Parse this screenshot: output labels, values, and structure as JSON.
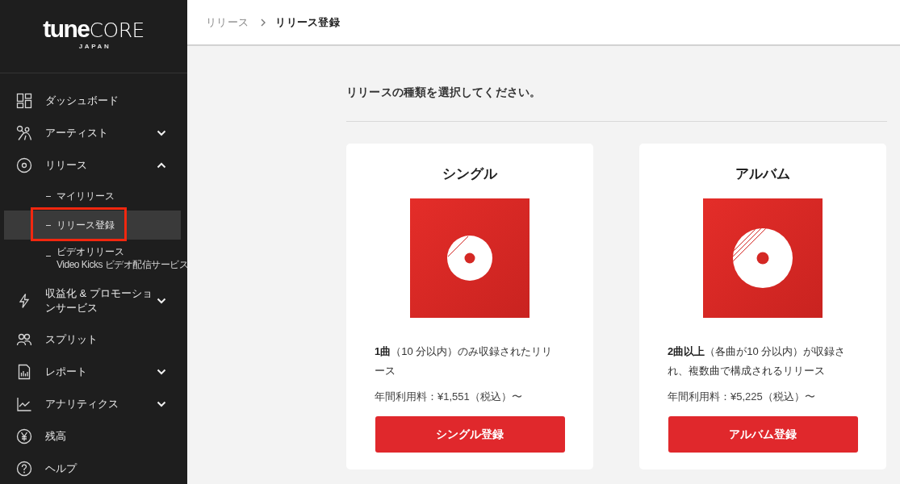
{
  "sidebar": {
    "logo": {
      "wordmark": "**tune**CORE",
      "subtitle": "JAPAN"
    },
    "items": [
      {
        "kind": "link",
        "label": "ダッシュボード"
      },
      {
        "kind": "group",
        "label": "アーティスト",
        "expanded": false
      },
      {
        "kind": "group",
        "label": "リリース",
        "expanded": true,
        "children": [
          {
            "label": "マイリリース",
            "selected": false,
            "annotated": false
          },
          {
            "label": "リリース登録",
            "selected": true,
            "annotated": true
          },
          {
            "label": "ビデオリリース",
            "note": "Video Kicks ビデオ配信サービス",
            "selected": false,
            "annotated": false
          }
        ]
      },
      {
        "kind": "group",
        "label": "収益化 & プロモーションサービス",
        "expanded": false
      },
      {
        "kind": "link",
        "label": "スプリット"
      },
      {
        "kind": "group",
        "label": "レポート",
        "expanded": false
      },
      {
        "kind": "group",
        "label": "アナリティクス",
        "expanded": false
      },
      {
        "kind": "link",
        "label": "残高"
      },
      {
        "kind": "link",
        "label": "ヘルプ"
      }
    ]
  },
  "breadcrumb": [
    {
      "label": "リリース",
      "current": false
    },
    {
      "label": "リリース登録",
      "current": true
    }
  ],
  "main": {
    "prompt": "リリースの種類を選択してください。",
    "options": [
      {
        "kind": "single",
        "title": "シングル",
        "description": "**1曲**（10 分以内）のみ収録されたリリース",
        "price": "年間利用料：¥1,551（税込）〜",
        "button": "シングル登録"
      },
      {
        "kind": "album",
        "title": "アルバム",
        "description": "**2曲以上**（各曲が10 分以内）が収録され、複数曲で構成されるリリース",
        "price": "年間利用料：¥5,225（税込）〜",
        "button": "アルバム登録"
      }
    ]
  }
}
